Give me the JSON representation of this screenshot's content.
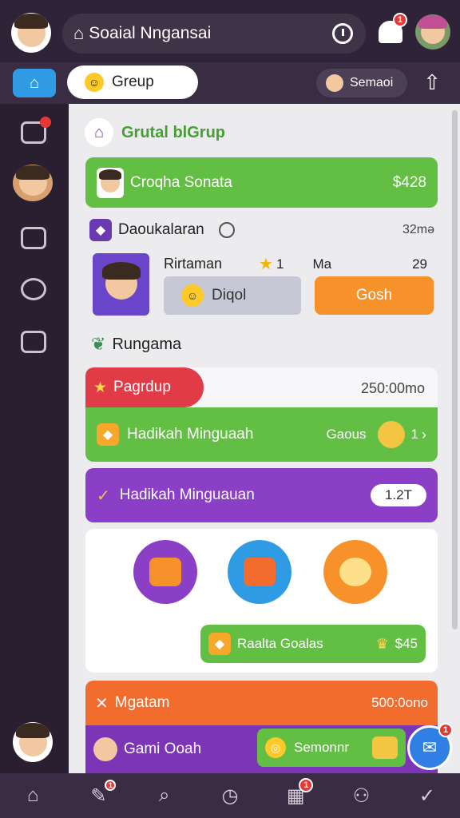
{
  "header": {
    "title": "Soaial Nngansai",
    "notif_count": "1"
  },
  "subbar": {
    "group_tab": "Grеup",
    "profile_chip": "Semaoi"
  },
  "group": {
    "title": "Grutal blGrup",
    "balance_label": "Croqha Sonata",
    "balance_value": "$428",
    "section_title": "Daoukalaran",
    "section_time": "32mə",
    "player_name": "Rirtaman",
    "player_score": "1",
    "player_col3": "Ma",
    "player_col4": "29",
    "btn_secondary": "Diqol",
    "btn_primary": "Gosh"
  },
  "rungama": {
    "title": "Rungama",
    "pill_label": "Pagrdup",
    "pill_time": "250:00mo",
    "green_bar_label": "Hadikah Minguaah",
    "green_bar_right": "Gaous",
    "green_bar_count": "1",
    "purple_bar_label": "Hadikah Minguauan",
    "purple_bar_value": "1.2T",
    "reward_label": "Raalta Goalas",
    "reward_value": "$45"
  },
  "bottom_cards": {
    "orange_label": "Mgatam",
    "orange_time": "500:0ono",
    "purple_label": "Gami Ooah",
    "purple_button": "Semonnr"
  },
  "bottom_nav": {
    "badge1": "1",
    "badge2": "1"
  },
  "chat_badge": "1",
  "colors": {
    "accent_green": "#63be44",
    "accent_purple": "#8a3fc6",
    "accent_orange": "#f7922a",
    "accent_red": "#e53935",
    "primary_blue": "#2f9be5"
  }
}
